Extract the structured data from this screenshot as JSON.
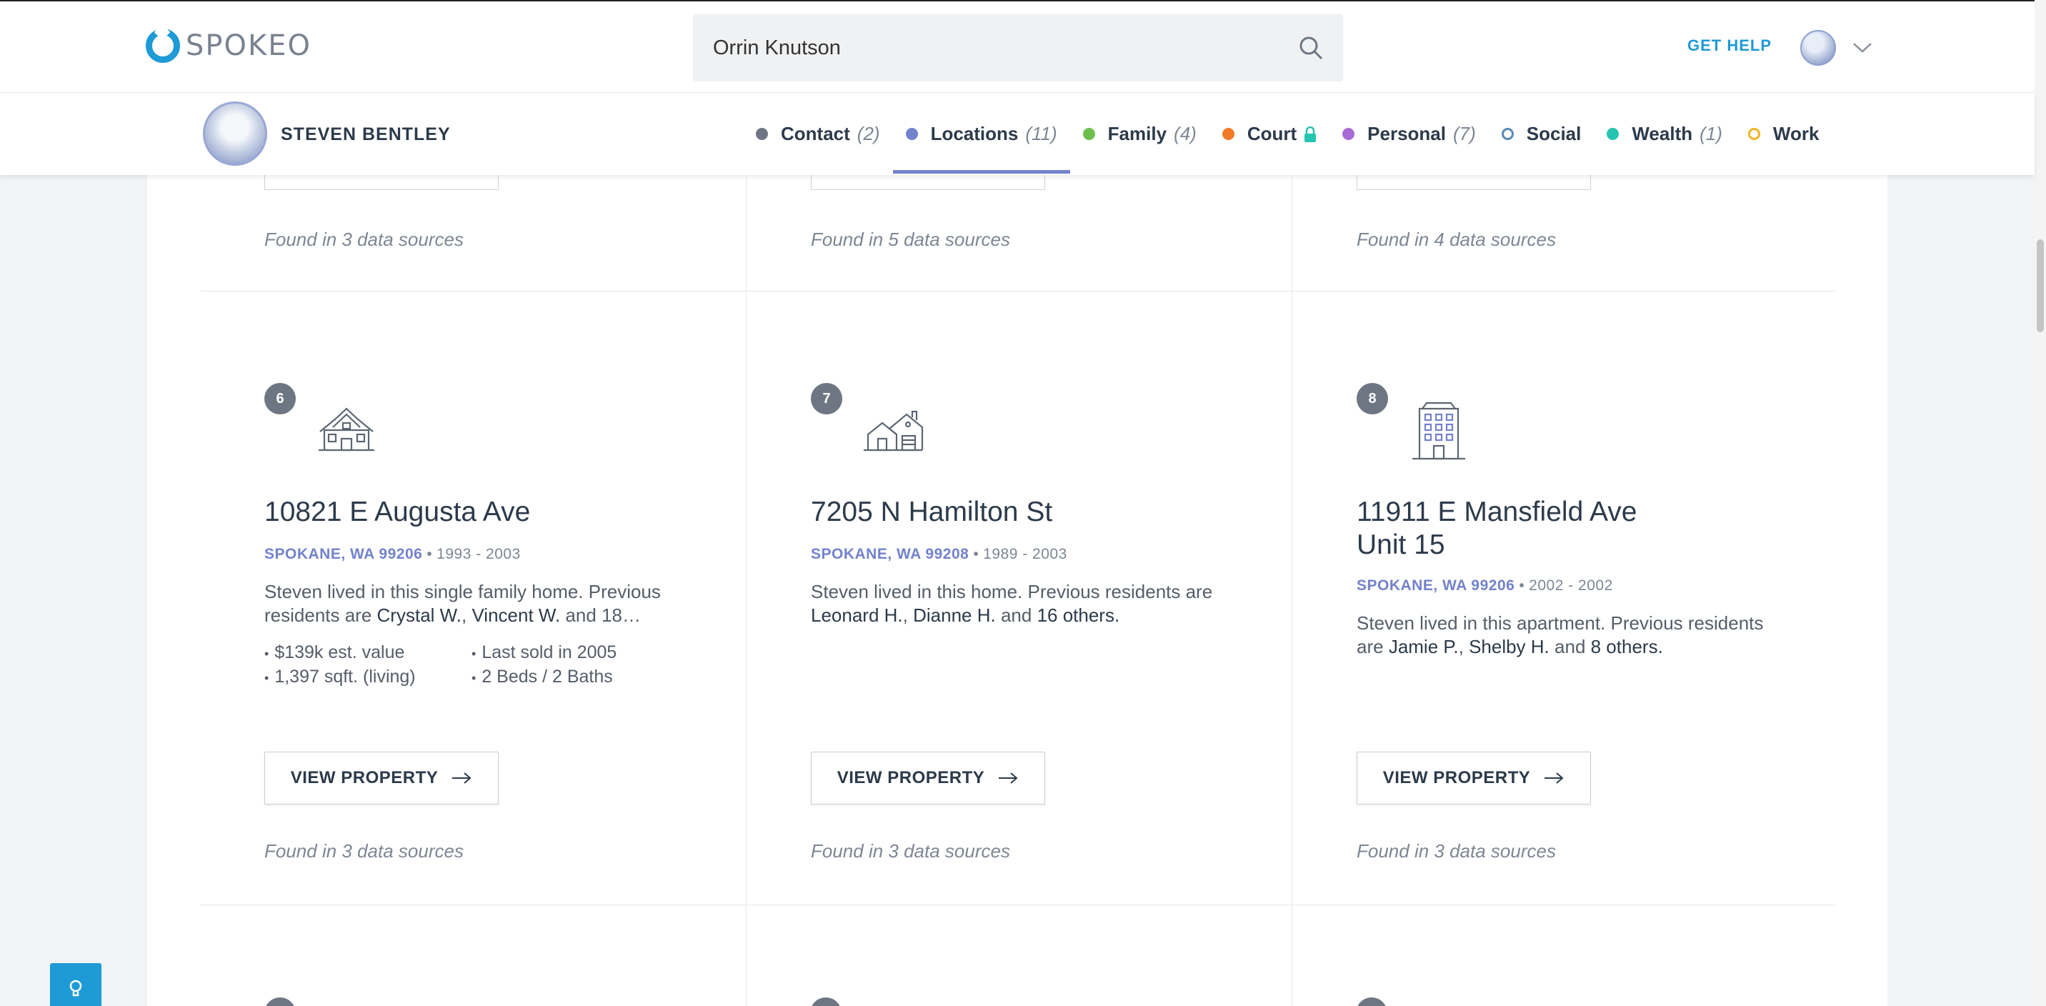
{
  "header": {
    "logo_text": "SPOKEO",
    "search_value": "Orrin Knutson",
    "get_help": "GET HELP"
  },
  "person": {
    "name": "STEVEN BENTLEY"
  },
  "tabs": [
    {
      "label": "Contact",
      "count": "(2)",
      "color": "#6d7682",
      "dot_style": "filled"
    },
    {
      "label": "Locations",
      "count": "(11)",
      "color": "#7382cc",
      "dot_style": "filled",
      "active": true
    },
    {
      "label": "Family",
      "count": "(4)",
      "color": "#6cc04a",
      "dot_style": "filled"
    },
    {
      "label": "Court",
      "count": "",
      "color": "#f07a26",
      "dot_style": "filled",
      "locked": true
    },
    {
      "label": "Personal",
      "count": "(7)",
      "color": "#a86bd6",
      "dot_style": "filled"
    },
    {
      "label": "Social",
      "count": "",
      "color": "#5a88b5",
      "dot_style": "ring"
    },
    {
      "label": "Wealth",
      "count": "(1)",
      "color": "#25c4b0",
      "dot_style": "filled"
    },
    {
      "label": "Work",
      "count": "",
      "color": "#f2b31e",
      "dot_style": "ring"
    }
  ],
  "prev_row": {
    "found": [
      "Found in 3 data sources",
      "Found in 5 data sources",
      "Found in 4 data sources"
    ]
  },
  "locations": [
    {
      "number": "6",
      "icon": "house-icon",
      "address_line1": "10821 E Augusta Ave",
      "address_line2": "",
      "city": "SPOKANE, WA 99206",
      "years": "1993 - 2003",
      "desc_pre": "Steven lived in this single family home. Previous residents are ",
      "name1": "Crystal W.",
      "mid1": ", ",
      "name2": "Vincent W.",
      "mid2": " and ",
      "tail": "18…",
      "facts": [
        "$139k est. value",
        "Last sold in 2005",
        "1,397 sqft. (living)",
        "2 Beds / 2 Baths"
      ],
      "button": "VIEW PROPERTY",
      "found": "Found in 3 data sources"
    },
    {
      "number": "7",
      "icon": "home-icon",
      "address_line1": "7205 N Hamilton St",
      "address_line2": "",
      "city": "SPOKANE, WA 99208",
      "years": "1989 - 2003",
      "desc_pre": "Steven lived in this home. Previous residents are ",
      "name1": "Leonard H.",
      "mid1": ", ",
      "name2": "Dianne H.",
      "mid2": " and ",
      "tail": "16 others.",
      "facts": [],
      "button": "VIEW PROPERTY",
      "found": "Found in 3 data sources"
    },
    {
      "number": "8",
      "icon": "apartment-building-icon",
      "address_line1": "11911 E Mansfield Ave",
      "address_line2": "Unit 15",
      "city": "SPOKANE, WA 99206",
      "years": "2002 - 2002",
      "desc_pre": "Steven lived in this apartment. Previous residents are ",
      "name1": "Jamie P.",
      "mid1": ", ",
      "name2": "Shelby H.",
      "mid2": " and ",
      "tail": "8 others.",
      "facts": [],
      "button": "VIEW PROPERTY",
      "found": "Found in 3 data sources"
    }
  ]
}
